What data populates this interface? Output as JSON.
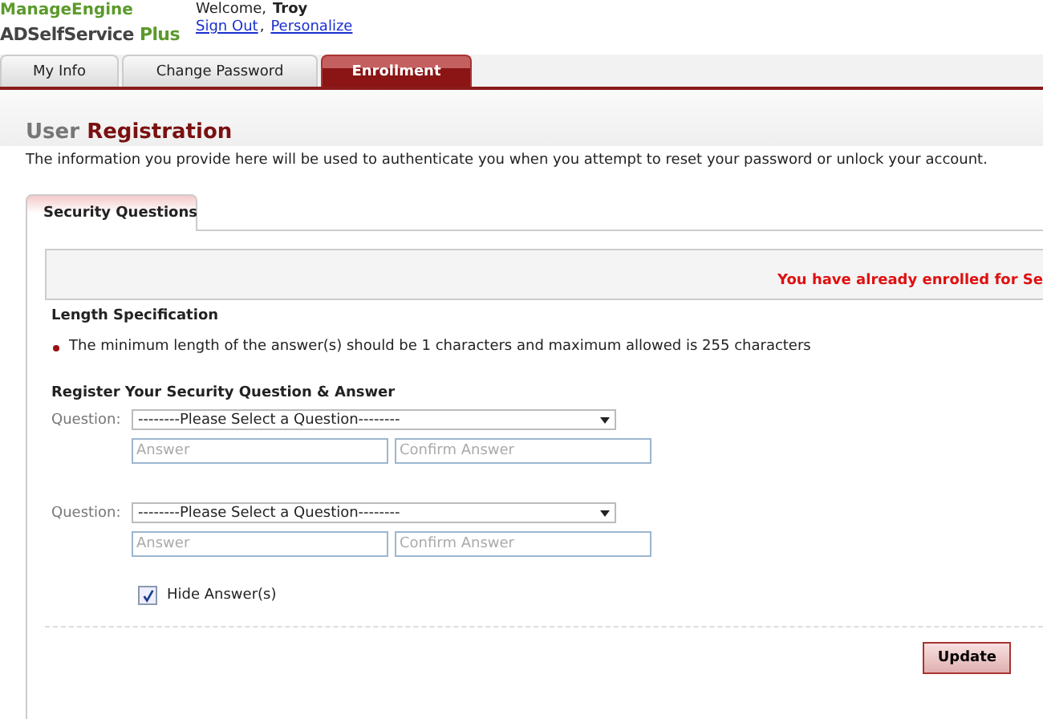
{
  "header": {
    "logo_top": "ManageEngine",
    "logo_main": "ADSelfService",
    "logo_plus": "Plus",
    "welcome": "Welcome,",
    "user": "Troy",
    "links": [
      {
        "label": "Sign Out"
      },
      {
        "label": "Personalize"
      }
    ],
    "link_separator": ","
  },
  "tabs": [
    {
      "label": "My Info",
      "selected": false
    },
    {
      "label": "Change Password",
      "selected": false
    },
    {
      "label": "Enrollment",
      "selected": true
    }
  ],
  "page": {
    "title_light": "User",
    "title_strong": "Registration",
    "description": "The information you provide here will be used to authenticate you when you attempt to reset your password or unlock your account."
  },
  "subtabs": [
    {
      "label": "Security Questions",
      "selected": true
    }
  ],
  "message": "You have already enrolled for Se",
  "length_spec": {
    "heading": "Length Specification",
    "rule": "The minimum length of the answer(s) should be 1 characters and maximum allowed is 255 characters"
  },
  "register_heading": "Register Your Security Question & Answer",
  "questions": [
    {
      "label": "Question:",
      "select": "--------Please Select a Question--------",
      "answer_placeholder": "Answer",
      "confirm_placeholder": "Confirm Answer"
    },
    {
      "label": "Question:",
      "select": "--------Please Select a Question--------",
      "answer_placeholder": "Answer",
      "confirm_placeholder": "Confirm Answer"
    }
  ],
  "hide_answers": {
    "label": "Hide Answer(s)",
    "checked": true
  },
  "buttons": [
    {
      "label": "Update"
    }
  ]
}
